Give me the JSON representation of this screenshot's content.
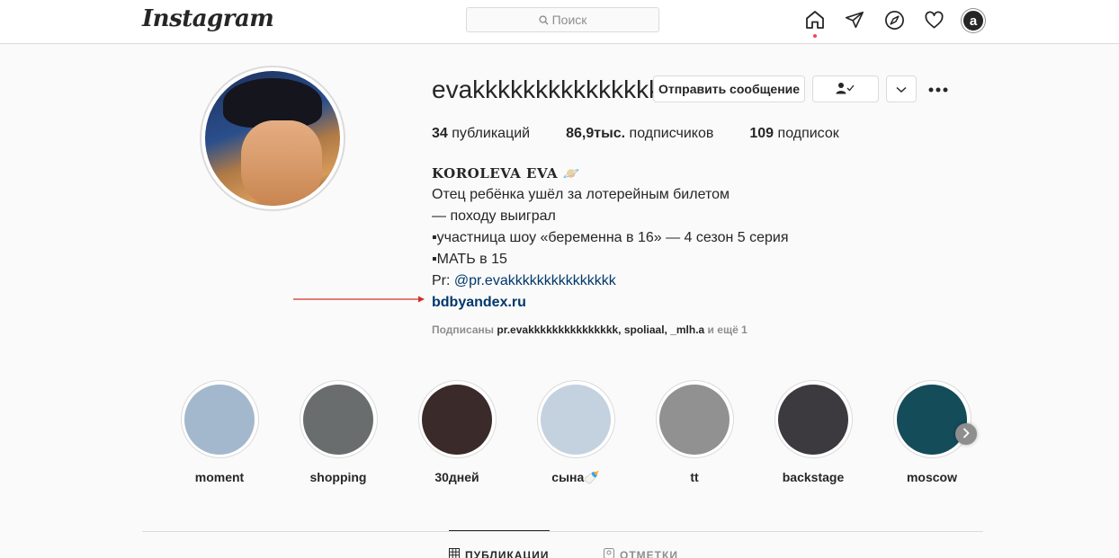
{
  "nav": {
    "logo": "Instagram",
    "search_placeholder": "Поиск",
    "avatar_letter": "a"
  },
  "profile": {
    "username": "evakkkkkkkkkkkkkkk",
    "message_button": "Отправить сообщение",
    "stats": {
      "posts_count": "34",
      "posts_label": "публикаций",
      "followers_count": "86,9тыс.",
      "followers_label": "подписчиков",
      "following_count": "109",
      "following_label": "подписок"
    },
    "bio": {
      "full_name": "KOROLEVA EVA 🪐",
      "lines": [
        "Отец ребёнка ушёл за лотерейным билетом",
        "— походу выиграл",
        "▪участница шоу «беременна в 16» — 4 сезон 5 серия",
        "▪МАТЬ в 15"
      ],
      "pr_prefix": "Pr: ",
      "pr_mention": "@pr.evakkkkkkkkkkkkkkk",
      "website": "bdbyandex.ru"
    },
    "followed_by": {
      "prefix": "Подписаны ",
      "names": "pr.evakkkkkkkkkkkkkkk, spoliaal, _mlh.a",
      "suffix": " и ещё 1"
    }
  },
  "highlights": [
    {
      "label": "moment",
      "color": "#a3b8cd"
    },
    {
      "label": "shopping",
      "color": "#6a6d6d"
    },
    {
      "label": "30дней",
      "color": "#3a2a2a"
    },
    {
      "label": "сына🍼",
      "color": "#c4d2e0"
    },
    {
      "label": "tt",
      "color": "#919191"
    },
    {
      "label": "backstage",
      "color": "#3c3a3e"
    },
    {
      "label": "moscow",
      "color": "#144c5a"
    }
  ],
  "tabs": {
    "posts": "ПУБЛИКАЦИИ",
    "tagged": "ОТМЕТКИ"
  },
  "colors": {
    "link": "#00376b",
    "notification_dot": "#ed4956",
    "annotation_arrow": "#d0302a"
  }
}
